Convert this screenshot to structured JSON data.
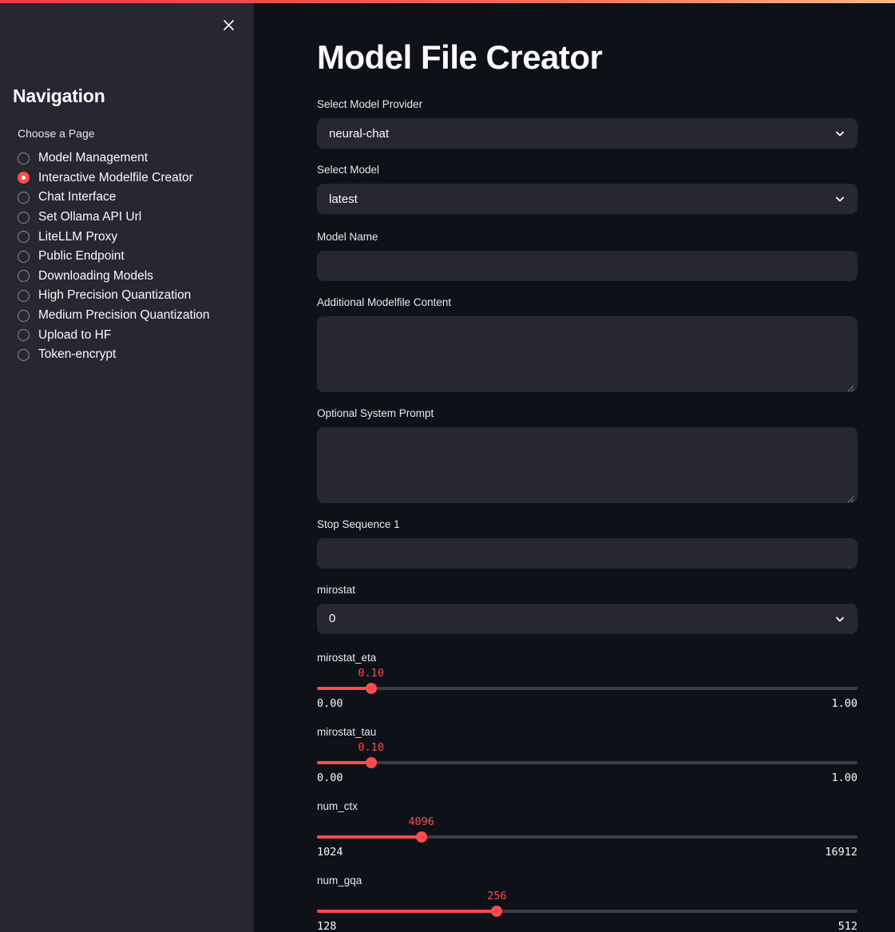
{
  "theme": {
    "accent": "#ff4b4b",
    "sidebar_bg": "#262730",
    "main_bg": "#0e1117",
    "control_bg": "#262730",
    "text": "#fafafa"
  },
  "sidebar": {
    "close_label": "×",
    "heading": "Navigation",
    "sublabel": "Choose a Page",
    "selected_index": 1,
    "items": [
      {
        "label": "Model Management"
      },
      {
        "label": "Interactive Modelfile Creator"
      },
      {
        "label": "Chat Interface"
      },
      {
        "label": "Set Ollama API Url"
      },
      {
        "label": "LiteLLM Proxy"
      },
      {
        "label": "Public Endpoint"
      },
      {
        "label": "Downloading Models"
      },
      {
        "label": "High Precision Quantization"
      },
      {
        "label": "Medium Precision Quantization"
      },
      {
        "label": "Upload to HF"
      },
      {
        "label": "Token-encrypt"
      }
    ]
  },
  "main": {
    "title": "Model File Creator",
    "fields": {
      "provider": {
        "label": "Select Model Provider",
        "value": "neural-chat"
      },
      "model": {
        "label": "Select Model",
        "value": "latest"
      },
      "model_name": {
        "label": "Model Name",
        "value": "",
        "placeholder": ""
      },
      "additional_content": {
        "label": "Additional Modelfile Content",
        "value": "",
        "placeholder": ""
      },
      "system_prompt": {
        "label": "Optional System Prompt",
        "value": "",
        "placeholder": ""
      },
      "stop_sequence_1": {
        "label": "Stop Sequence 1",
        "value": "",
        "placeholder": ""
      },
      "mirostat": {
        "label": "mirostat",
        "value": "0"
      }
    },
    "sliders": [
      {
        "name": "mirostat_eta",
        "value": "0.10",
        "min": "0.00",
        "max": "1.00",
        "percent": 10
      },
      {
        "name": "mirostat_tau",
        "value": "0.10",
        "min": "0.00",
        "max": "1.00",
        "percent": 10
      },
      {
        "name": "num_ctx",
        "value": "4096",
        "min": "1024",
        "max": "16912",
        "percent": 19.3
      },
      {
        "name": "num_gqa",
        "value": "256",
        "min": "128",
        "max": "512",
        "percent": 33.3
      }
    ]
  }
}
